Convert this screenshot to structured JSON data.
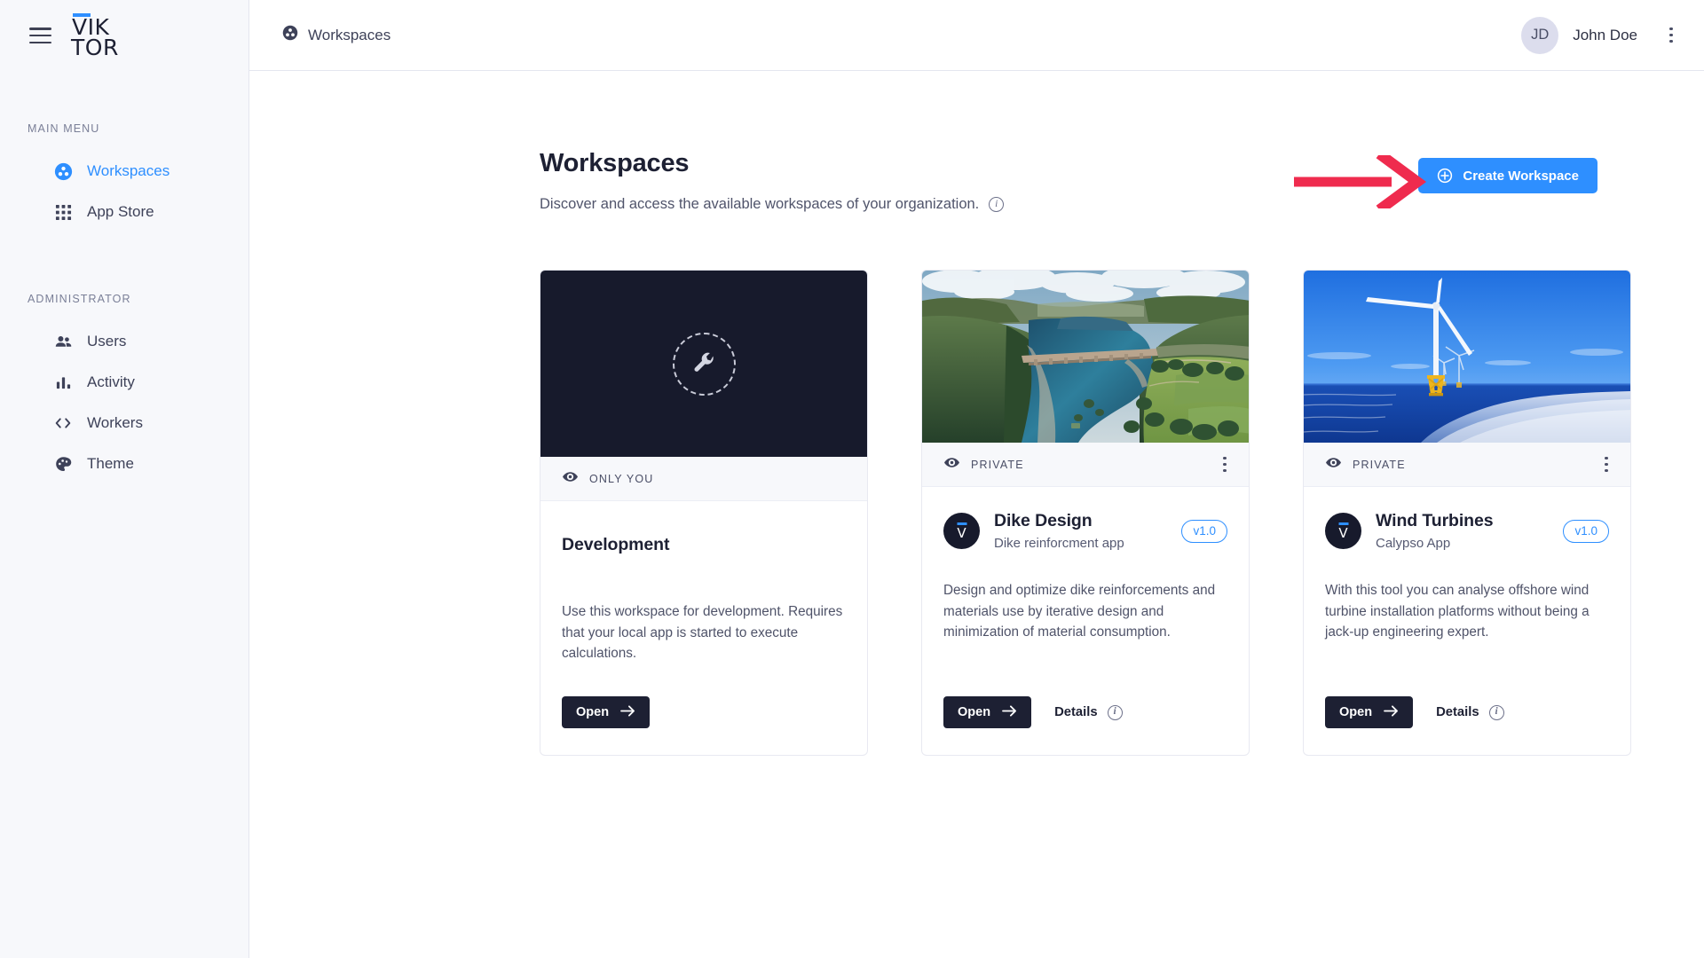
{
  "brand": {
    "logo_line1": "VIK",
    "logo_line2": "TOR",
    "accent": "#2e8fff"
  },
  "sidebar": {
    "sections": [
      {
        "label": "MAIN MENU",
        "items": [
          {
            "label": "Workspaces",
            "icon": "workspaces-icon",
            "active": true
          },
          {
            "label": "App Store",
            "icon": "grid-icon",
            "active": false
          }
        ]
      },
      {
        "label": "ADMINISTRATOR",
        "items": [
          {
            "label": "Users",
            "icon": "users-icon",
            "active": false
          },
          {
            "label": "Activity",
            "icon": "bar-chart-icon",
            "active": false
          },
          {
            "label": "Workers",
            "icon": "code-brackets-icon",
            "active": false
          },
          {
            "label": "Theme",
            "icon": "palette-icon",
            "active": false
          }
        ]
      }
    ]
  },
  "topbar": {
    "breadcrumb": "Workspaces",
    "breadcrumb_icon": "workspaces-icon",
    "user_initials": "JD",
    "user_name": "John Doe",
    "overflow_icon": "kebab-menu-icon"
  },
  "page": {
    "title": "Workspaces",
    "subtitle": "Discover and access the available workspaces of your organization.",
    "subtitle_info_icon": "info-icon",
    "create_button": "Create Workspace",
    "create_button_icon": "plus-circle-icon",
    "create_button_color": "#2e8fff",
    "annotation_arrow": {
      "icon": "red-arrow-right",
      "color": "#ef2b4e"
    }
  },
  "cards": [
    {
      "name": "Development",
      "visibility": "ONLY YOU",
      "visibility_icon": "eye-icon",
      "media": "wrench-placeholder",
      "has_menu": false,
      "has_avatar": false,
      "subtitle": "",
      "version": "",
      "description": "Use this workspace for development. Requires that your local app is started to execute calculations.",
      "open_label": "Open",
      "open_icon": "arrow-right-icon",
      "details_label": "",
      "details_icon": ""
    },
    {
      "name": "Dike Design",
      "visibility": "PRIVATE",
      "visibility_icon": "eye-icon",
      "media": "aerial-reservoir-photo",
      "has_menu": true,
      "has_avatar": true,
      "subtitle": "Dike reinforcment app",
      "version": "v1.0",
      "description": "Design and optimize dike reinforcements and materials use by iterative design and minimization of material consumption.",
      "open_label": "Open",
      "open_icon": "arrow-right-icon",
      "details_label": "Details",
      "details_icon": "info-icon"
    },
    {
      "name": "Wind Turbines",
      "visibility": "PRIVATE",
      "visibility_icon": "eye-icon",
      "media": "offshore-wind-turbine-photo",
      "has_menu": true,
      "has_avatar": true,
      "subtitle": "Calypso App",
      "version": "v1.0",
      "description": "With this tool you can analyse offshore wind turbine installation platforms without being a jack-up engineering expert.",
      "open_label": "Open",
      "open_icon": "arrow-right-icon",
      "details_label": "Details",
      "details_icon": "info-icon"
    }
  ]
}
